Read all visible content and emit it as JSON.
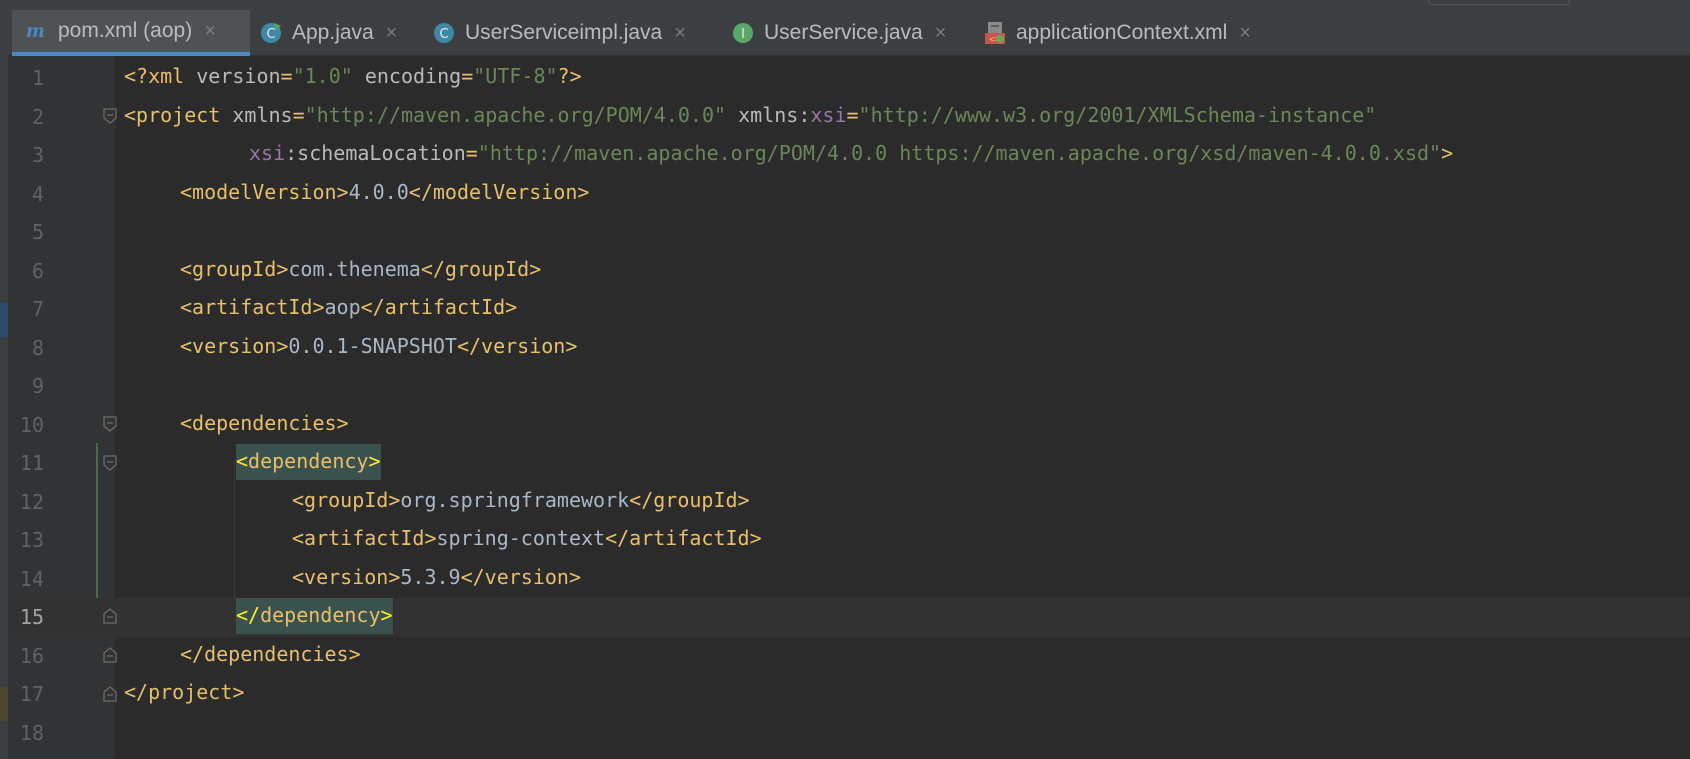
{
  "tabs": [
    {
      "label": "pom.xml (aop)",
      "icon": "maven-icon",
      "active": true
    },
    {
      "label": "App.java",
      "icon": "java-class-run-icon",
      "active": false
    },
    {
      "label": "UserServiceimpl.java",
      "icon": "java-class-icon",
      "active": false
    },
    {
      "label": "UserService.java",
      "icon": "java-interface-icon",
      "active": false
    },
    {
      "label": "applicationContext.xml",
      "icon": "spring-xml-icon",
      "active": false
    }
  ],
  "tab_close_glyph": "×",
  "editor": {
    "current_line": 15,
    "lines": [
      {
        "n": "1"
      },
      {
        "n": "2"
      },
      {
        "n": "3"
      },
      {
        "n": "4"
      },
      {
        "n": "5"
      },
      {
        "n": "6"
      },
      {
        "n": "7"
      },
      {
        "n": "8"
      },
      {
        "n": "9"
      },
      {
        "n": "10"
      },
      {
        "n": "11"
      },
      {
        "n": "12"
      },
      {
        "n": "13"
      },
      {
        "n": "14"
      },
      {
        "n": "15"
      },
      {
        "n": "16"
      },
      {
        "n": "17"
      },
      {
        "n": "18"
      }
    ],
    "code": {
      "l1": {
        "decl_open": "<?xml ",
        "version_attr": "version",
        "eq1": "=",
        "version_val": "\"1.0\"",
        "enc_attr": " encoding",
        "eq2": "=",
        "enc_val": "\"UTF-8\"",
        "decl_close": "?>"
      },
      "l2": {
        "open": "<project ",
        "xmlns_attr": "xmlns",
        "eq1": "=",
        "xmlns_val": "\"http://maven.apache.org/POM/4.0.0\"",
        "xmlns2_attr": " xmlns:",
        "xsi_ns": "xsi",
        "eq2": "=",
        "xsi_val": "\"http://www.w3.org/2001/XMLSchema-instance\""
      },
      "l3": {
        "xsi_ns": "xsi",
        "attr": ":schemaLocation",
        "eq": "=",
        "val": "\"http://maven.apache.org/POM/4.0.0 https://maven.apache.org/xsd/maven-4.0.0.xsd\"",
        "close": ">"
      },
      "l4": {
        "open": "<modelVersion>",
        "text": "4.0.0",
        "close": "</modelVersion>"
      },
      "l6": {
        "open": "<groupId>",
        "text": "com.thenema",
        "close": "</groupId>"
      },
      "l7": {
        "open": "<artifactId>",
        "text": "aop",
        "close": "</artifactId>"
      },
      "l8": {
        "open": "<version>",
        "text": "0.0.1-SNAPSHOT",
        "close": "</version>"
      },
      "l10": {
        "open": "<dependencies>"
      },
      "l11": {
        "lt": "<",
        "name": "dependency",
        "gt": ">"
      },
      "l12": {
        "open": "<groupId>",
        "text": "org.springframework",
        "close": "</groupId>"
      },
      "l13": {
        "open": "<artifactId>",
        "text": "spring-context",
        "close": "</artifactId>"
      },
      "l14": {
        "open": "<version>",
        "text": "5.3.9",
        "close": "</version>"
      },
      "l15": {
        "lt": "</",
        "name": "dependency",
        "gt": ">"
      },
      "l16": {
        "close": "</dependencies>"
      },
      "l17": {
        "close": "</project>"
      }
    }
  },
  "colors": {
    "tag": "#e8bf6a",
    "text": "#a9b7c6",
    "string": "#6a8759",
    "namespace": "#9876aa",
    "match_highlight_bg": "#3b514d",
    "match_highlight_fg": "#ffef28",
    "active_tab_underline": "#4a88c7"
  }
}
